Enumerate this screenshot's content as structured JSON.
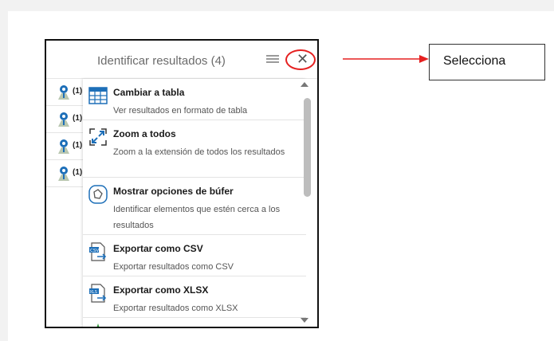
{
  "panel": {
    "title": "Identificar resultados (4)"
  },
  "results": [
    {
      "count": "(1)"
    },
    {
      "count": "(1)"
    },
    {
      "count": "(1)"
    },
    {
      "count": "(1)"
    }
  ],
  "menu": {
    "items": [
      {
        "label": "Cambiar a tabla",
        "desc": "Ver resultados en formato de tabla",
        "icon": "table-icon"
      },
      {
        "label": "Zoom a todos",
        "desc": "Zoom a la extensión de todos los resultados",
        "icon": "zoom-extent-icon"
      },
      {
        "label": "Mostrar opciones de búfer",
        "desc": "Identificar elementos que estén cerca a los resultados",
        "icon": "buffer-icon"
      },
      {
        "label": "Exportar como CSV",
        "desc": "Exportar resultados como CSV",
        "icon": "csv-export-icon"
      },
      {
        "label": "Exportar como XLSX",
        "desc": "Exportar resultados como XLSX",
        "icon": "xlsx-export-icon"
      }
    ]
  },
  "callout": {
    "text": "Selecciona"
  },
  "colors": {
    "annotation_red": "#e52020",
    "icon_blue": "#1d6fb8"
  }
}
